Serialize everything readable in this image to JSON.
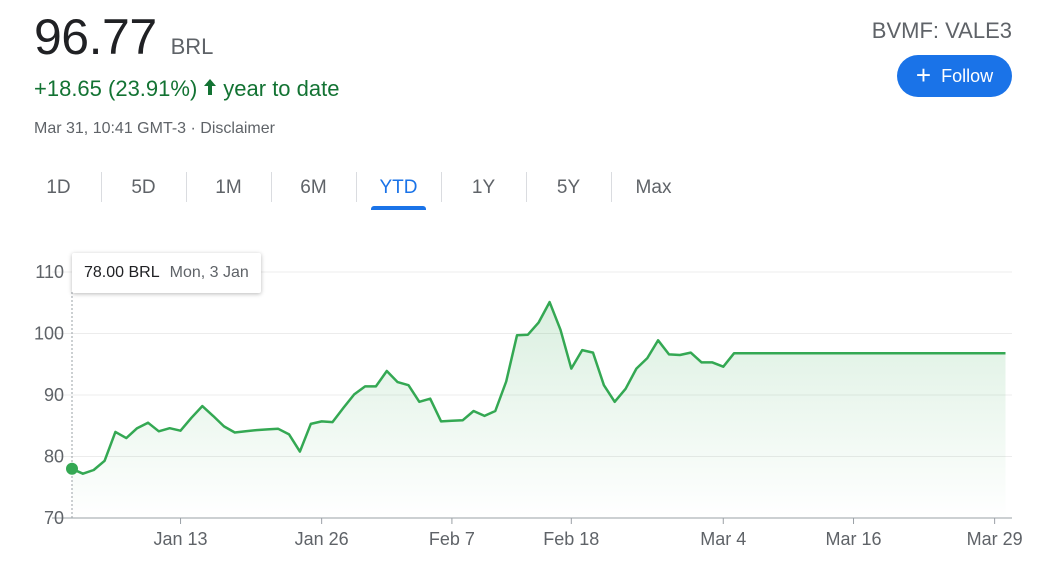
{
  "header": {
    "price": "96.77",
    "currency": "BRL",
    "change": "+18.65 (23.91%)",
    "period_label": "year to date",
    "ticker": "BVMF: VALE3",
    "follow_label": "Follow",
    "timestamp": "Mar 31, 10:41 GMT-3 · Disclaimer"
  },
  "tabs": [
    {
      "label": "1D"
    },
    {
      "label": "5D"
    },
    {
      "label": "1M"
    },
    {
      "label": "6M"
    },
    {
      "label": "YTD",
      "active": true
    },
    {
      "label": "1Y"
    },
    {
      "label": "5Y"
    },
    {
      "label": "Max"
    }
  ],
  "tooltip": {
    "price": "78.00 BRL",
    "date": "Mon, 3 Jan"
  },
  "colors": {
    "positive": "#137333",
    "line": "#34a853",
    "accent": "#1a73e8"
  },
  "chart_data": {
    "type": "area",
    "title": "",
    "xlabel": "",
    "ylabel": "",
    "ylim": [
      70,
      110
    ],
    "yticks": [
      70,
      80,
      90,
      100,
      110
    ],
    "grid": true,
    "x_tick_labels": [
      {
        "label": "Jan 13",
        "day": 12
      },
      {
        "label": "Jan 26",
        "day": 25
      },
      {
        "label": "Feb 7",
        "day": 37
      },
      {
        "label": "Feb 18",
        "day": 48
      },
      {
        "label": "Mar 4",
        "day": 62
      },
      {
        "label": "Mar 16",
        "day": 74
      },
      {
        "label": "Mar 29",
        "day": 87
      }
    ],
    "x_domain": [
      2,
      88.6
    ],
    "series": [
      {
        "name": "",
        "x": [
          2,
          3,
          4,
          5,
          6,
          7,
          8,
          9,
          10,
          11,
          12,
          13,
          14,
          15,
          16,
          17,
          18,
          19,
          20,
          21,
          22,
          23,
          24,
          25,
          26,
          27,
          28,
          29,
          30,
          31,
          32,
          33,
          34,
          35,
          36,
          37,
          38,
          39,
          40,
          41,
          42,
          43,
          44,
          45,
          46,
          47,
          48,
          49,
          50,
          51,
          52,
          53,
          54,
          55,
          56,
          57,
          58,
          59,
          60,
          61,
          62,
          63,
          64,
          65,
          66,
          67,
          68,
          69,
          70,
          71,
          72,
          73,
          74,
          75,
          76,
          77,
          78,
          79,
          80,
          81,
          82,
          83,
          84,
          85,
          86,
          87,
          88
        ],
        "values": [
          78.0,
          77.2,
          77.8,
          79.3,
          84.0,
          83.0,
          84.6,
          85.5,
          84.1,
          84.6,
          84.2,
          86.3,
          88.2,
          86.6,
          84.9,
          83.9,
          84.1,
          84.3,
          84.4,
          84.5,
          83.6,
          80.8,
          85.3,
          85.7,
          85.6,
          87.9,
          90.1,
          91.4,
          91.4,
          93.9,
          92.1,
          91.6,
          88.9,
          89.4,
          85.7,
          85.8,
          85.9,
          87.4,
          86.6,
          87.4,
          92.2,
          99.7,
          99.8,
          101.8,
          105.1,
          100.6,
          94.3,
          97.3,
          96.9,
          91.6,
          88.9,
          91.0,
          94.3,
          96.0,
          98.9,
          96.6,
          96.5,
          96.9,
          95.3,
          95.3,
          94.6,
          96.8,
          96.8,
          96.8,
          96.8,
          96.8,
          96.8,
          96.8,
          96.8,
          96.8,
          96.8,
          96.8,
          96.8,
          96.8,
          96.8,
          96.8,
          96.8,
          96.8,
          96.8,
          96.8,
          96.8,
          96.8,
          96.8,
          96.8,
          96.8,
          96.8,
          96.8
        ]
      }
    ],
    "marker": {
      "day": 2,
      "value": 78.0
    }
  }
}
